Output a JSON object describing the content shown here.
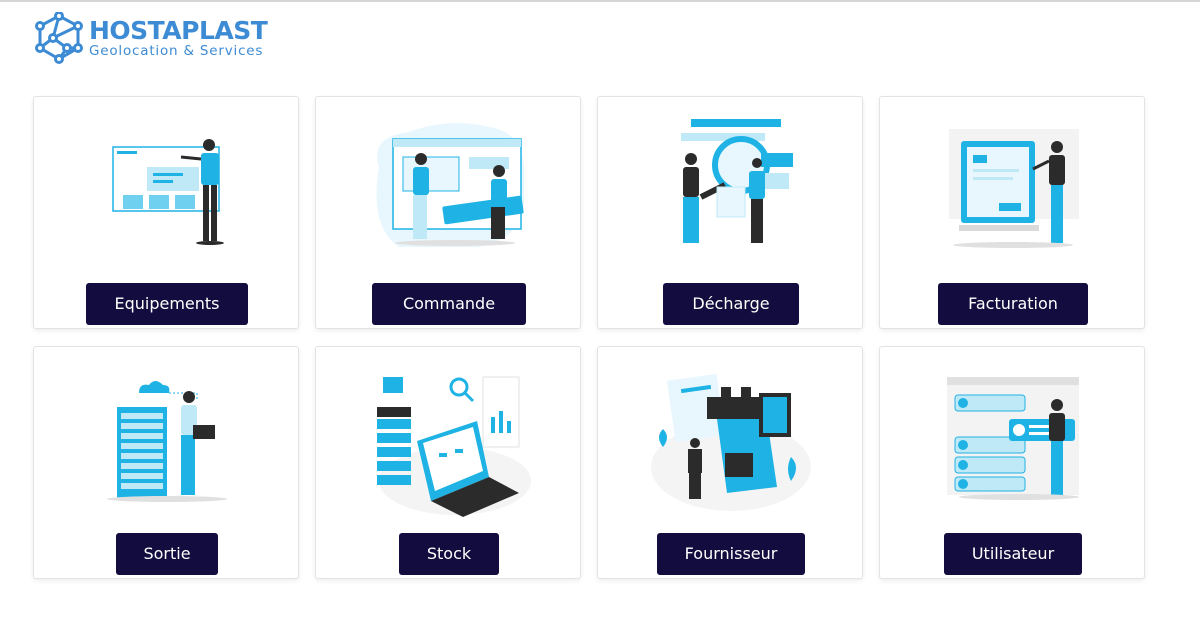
{
  "brand": {
    "name": "HOSTAPLAST",
    "tagline": "Geolocation & Services"
  },
  "colors": {
    "accent": "#1fb3e5",
    "button_bg": "#120d3e",
    "logo_blue": "#3d8bd4"
  },
  "cards": [
    {
      "label": "Equipements",
      "illustration": "person-pointing-at-dashboard"
    },
    {
      "label": "Commande",
      "illustration": "two-people-with-browser-window"
    },
    {
      "label": "Décharge",
      "illustration": "two-people-with-magnifier"
    },
    {
      "label": "Facturation",
      "illustration": "person-with-invoice-screen"
    },
    {
      "label": "Sortie",
      "illustration": "person-with-server-rack"
    },
    {
      "label": "Stock",
      "illustration": "laptop-with-server-and-charts"
    },
    {
      "label": "Fournisseur",
      "illustration": "person-with-supplier-documents"
    },
    {
      "label": "Utilisateur",
      "illustration": "person-with-user-list"
    }
  ]
}
